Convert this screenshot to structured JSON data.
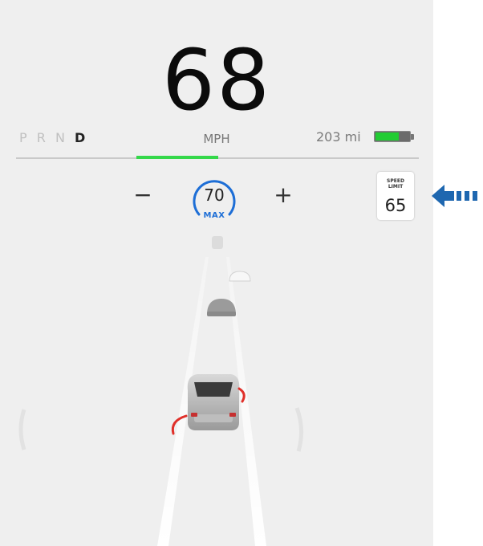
{
  "drive": {
    "speed": "68",
    "unit": "MPH",
    "gears": [
      "P",
      "R",
      "N",
      "D"
    ],
    "active_gear": "D",
    "range": "203 mi",
    "battery_level": 0.7,
    "accel_color": "#34d84a"
  },
  "cruise": {
    "decrease_label": "−",
    "increase_label": "+",
    "set_speed": "70",
    "max_label": "MAX",
    "accent": "#1d6ed6"
  },
  "speed_limit": {
    "title": "SPEED\nLIMIT",
    "value": "65"
  },
  "visualization": {
    "vehicles_ahead": 3,
    "blind_spot_color": "#e0302a"
  },
  "callout": {
    "icon": "arrow-left-icon",
    "color": "#1e67b0"
  }
}
